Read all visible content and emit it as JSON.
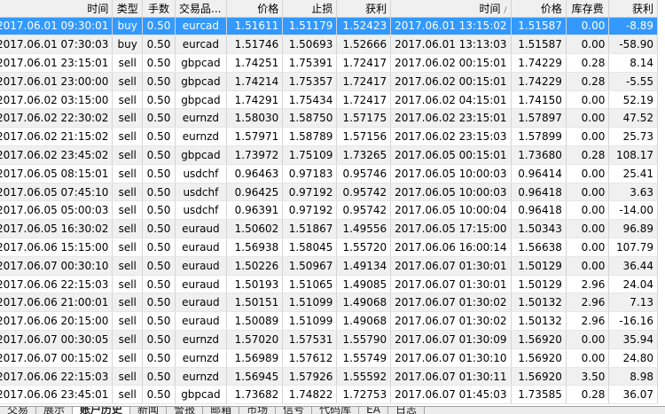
{
  "columns": [
    "时间",
    "类型",
    "手数",
    "交易品...",
    "价格",
    "止损",
    "获利",
    "时间",
    "价格",
    "库存费",
    "获利"
  ],
  "sort_mark": "/",
  "rows": [
    [
      "2017.06.01 09:30:01",
      "buy",
      "0.50",
      "eurcad",
      "1.51611",
      "1.51179",
      "1.52423",
      "2017.06.01 13:15:02",
      "1.51587",
      "0.00",
      "-8.89"
    ],
    [
      "2017.06.01 07:30:03",
      "buy",
      "0.50",
      "eurcad",
      "1.51746",
      "1.50693",
      "1.52666",
      "2017.06.01 13:13:03",
      "1.51587",
      "0.00",
      "-58.90"
    ],
    [
      "2017.06.01 23:15:01",
      "sell",
      "0.50",
      "gbpcad",
      "1.74251",
      "1.75391",
      "1.72417",
      "2017.06.02 00:15:01",
      "1.74229",
      "0.28",
      "8.14"
    ],
    [
      "2017.06.01 23:00:00",
      "sell",
      "0.50",
      "gbpcad",
      "1.74214",
      "1.75357",
      "1.72417",
      "2017.06.02 00:15:01",
      "1.74229",
      "0.28",
      "-5.55"
    ],
    [
      "2017.06.02 03:15:00",
      "sell",
      "0.50",
      "gbpcad",
      "1.74291",
      "1.75434",
      "1.72417",
      "2017.06.02 04:15:01",
      "1.74150",
      "0.00",
      "52.19"
    ],
    [
      "2017.06.02 22:30:02",
      "sell",
      "0.50",
      "eurnzd",
      "1.58030",
      "1.58750",
      "1.57175",
      "2017.06.02 23:15:01",
      "1.57897",
      "0.00",
      "47.52"
    ],
    [
      "2017.06.02 21:15:02",
      "sell",
      "0.50",
      "eurnzd",
      "1.57971",
      "1.58789",
      "1.57156",
      "2017.06.02 23:15:03",
      "1.57899",
      "0.00",
      "25.73"
    ],
    [
      "2017.06.02 23:45:02",
      "sell",
      "0.50",
      "gbpcad",
      "1.73972",
      "1.75109",
      "1.73265",
      "2017.06.05 00:15:01",
      "1.73680",
      "0.28",
      "108.17"
    ],
    [
      "2017.06.05 08:15:01",
      "sell",
      "0.50",
      "usdchf",
      "0.96463",
      "0.97183",
      "0.95746",
      "2017.06.05 10:00:03",
      "0.96414",
      "0.00",
      "25.41"
    ],
    [
      "2017.06.05 07:45:10",
      "sell",
      "0.50",
      "usdchf",
      "0.96425",
      "0.97192",
      "0.95742",
      "2017.06.05 10:00:03",
      "0.96418",
      "0.00",
      "3.63"
    ],
    [
      "2017.06.05 05:00:03",
      "sell",
      "0.50",
      "usdchf",
      "0.96391",
      "0.97192",
      "0.95742",
      "2017.06.05 10:00:04",
      "0.96418",
      "0.00",
      "-14.00"
    ],
    [
      "2017.06.05 16:30:02",
      "sell",
      "0.50",
      "euraud",
      "1.50602",
      "1.51867",
      "1.49556",
      "2017.06.05 17:15:00",
      "1.50343",
      "0.00",
      "96.89"
    ],
    [
      "2017.06.06 15:15:00",
      "sell",
      "0.50",
      "euraud",
      "1.56938",
      "1.58045",
      "1.55720",
      "2017.06.06 16:00:14",
      "1.56638",
      "0.00",
      "107.79"
    ],
    [
      "2017.06.07 00:30:10",
      "sell",
      "0.50",
      "euraud",
      "1.50226",
      "1.50967",
      "1.49134",
      "2017.06.07 01:30:01",
      "1.50129",
      "0.00",
      "36.44"
    ],
    [
      "2017.06.06 22:15:03",
      "sell",
      "0.50",
      "euraud",
      "1.50193",
      "1.51065",
      "1.49085",
      "2017.06.07 01:30:01",
      "1.50129",
      "2.96",
      "24.04"
    ],
    [
      "2017.06.06 21:00:01",
      "sell",
      "0.50",
      "euraud",
      "1.50151",
      "1.51099",
      "1.49068",
      "2017.06.07 01:30:02",
      "1.50132",
      "2.96",
      "7.13"
    ],
    [
      "2017.06.06 20:15:00",
      "sell",
      "0.50",
      "euraud",
      "1.50089",
      "1.51099",
      "1.49068",
      "2017.06.07 01:30:02",
      "1.50132",
      "2.96",
      "-16.16"
    ],
    [
      "2017.06.07 00:30:05",
      "sell",
      "0.50",
      "eurnzd",
      "1.57020",
      "1.57531",
      "1.55790",
      "2017.06.07 01:30:09",
      "1.56920",
      "0.00",
      "35.94"
    ],
    [
      "2017.06.07 00:15:02",
      "sell",
      "0.50",
      "eurnzd",
      "1.56989",
      "1.57612",
      "1.55749",
      "2017.06.07 01:30:10",
      "1.56920",
      "0.00",
      "24.80"
    ],
    [
      "2017.06.06 22:15:03",
      "sell",
      "0.50",
      "eurnzd",
      "1.56945",
      "1.57926",
      "1.55592",
      "2017.06.07 01:30:11",
      "1.56920",
      "3.50",
      "8.98"
    ],
    [
      "2017.06.06 23:45:01",
      "sell",
      "0.50",
      "gbpcad",
      "1.73682",
      "1.74822",
      "1.72753",
      "2017.06.07 01:45:03",
      "1.73585",
      "0.28",
      "36.07"
    ]
  ],
  "tabs": [
    "交易",
    "展示",
    "账户历史",
    "新闻",
    "警报",
    "邮箱",
    "市场",
    "信号",
    "代码库",
    "EA",
    "日志"
  ],
  "active_tab_index": 2,
  "colors": {
    "selected_row": "#3399ff",
    "alt_row": "#f0f0f0",
    "header": "#f0f0f0"
  }
}
